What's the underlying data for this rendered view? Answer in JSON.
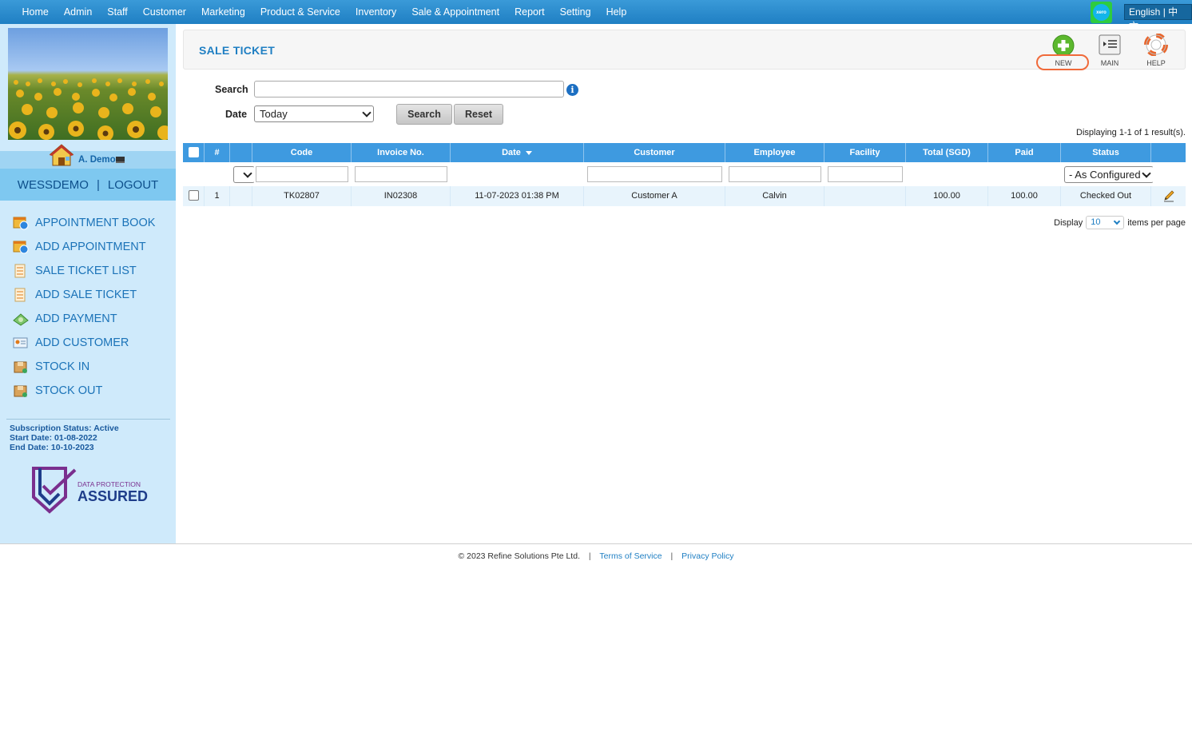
{
  "topnav": {
    "items": [
      "Home",
      "Admin",
      "Staff",
      "Customer",
      "Marketing",
      "Product & Service",
      "Inventory",
      "Sale & Appointment",
      "Report",
      "Setting",
      "Help"
    ],
    "language": "English | 中文",
    "xero_badge": "xero"
  },
  "sidebar": {
    "user_name": "A. Demo",
    "account": "WESSDEMO",
    "separator": "|",
    "logout": "LOGOUT",
    "nav": [
      "APPOINTMENT BOOK",
      "ADD APPOINTMENT",
      "SALE TICKET LIST",
      "ADD SALE TICKET",
      "ADD PAYMENT",
      "ADD CUSTOMER",
      "STOCK IN",
      "STOCK OUT"
    ],
    "subscription": {
      "status": "Subscription Status: Active",
      "start": "Start Date: 01-08-2022",
      "end": "End Date: 10-10-2023"
    },
    "badge": {
      "line1": "DATA PROTECTION",
      "line2": "ASSURED"
    }
  },
  "header": {
    "title": "SALE TICKET",
    "tools": [
      "NEW",
      "MAIN",
      "HELP"
    ]
  },
  "form": {
    "search_label": "Search",
    "search_value": "",
    "date_label": "Date",
    "date_value": "Today",
    "search_button": "Search",
    "reset_button": "Reset"
  },
  "results_text": "Displaying 1-1 of 1 result(s).",
  "table": {
    "columns": [
      "",
      "#",
      "",
      "Code",
      "Invoice No.",
      "Date",
      "Customer",
      "Employee",
      "Facility",
      "Total (SGD)",
      "Paid",
      "Status",
      ""
    ],
    "status_filter": "- As Configured -",
    "rows": [
      {
        "num": "1",
        "code": "TK02807",
        "invoice": "IN02308",
        "date": "11-07-2023 01:38 PM",
        "customer": "Customer A",
        "employee": "Calvin",
        "facility": "",
        "total": "100.00",
        "paid": "100.00",
        "status": "Checked Out"
      }
    ]
  },
  "pagination": {
    "display_label": "Display",
    "per_page": "10",
    "suffix": "items per page"
  },
  "footer": {
    "copyright": "© 2023 Refine Solutions Pte Ltd.",
    "pipe": "|",
    "terms": "Terms of Service",
    "privacy": "Privacy Policy"
  },
  "colors": {
    "nav_blue": "#1f7fc3",
    "header_blue": "#3e9ae0",
    "sidebar_bg": "#cfeafb",
    "highlight": "#f06a3a"
  }
}
